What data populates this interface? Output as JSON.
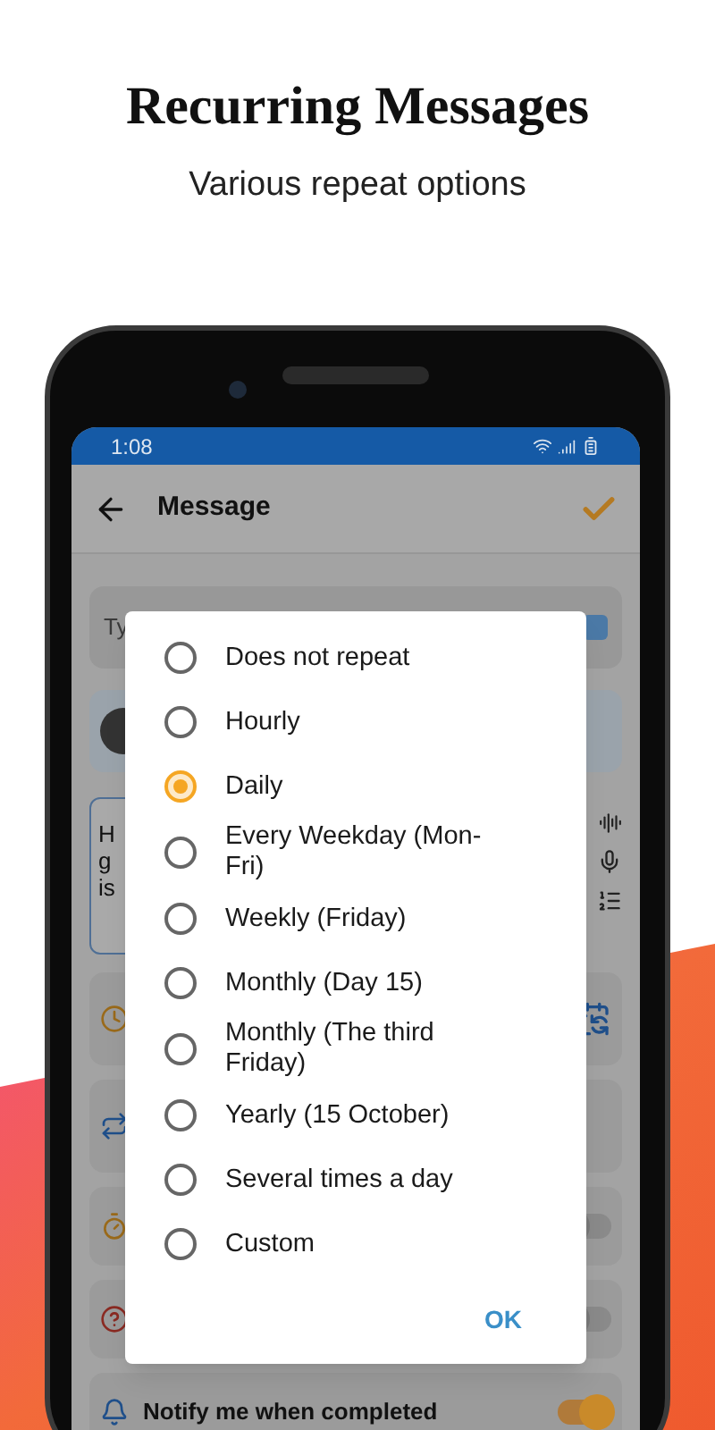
{
  "header": {
    "title": "Recurring Messages",
    "subtitle": "Various repeat options"
  },
  "status_bar": {
    "time": "1:08"
  },
  "app_bar": {
    "title": "Message"
  },
  "compose": {
    "recipient_placeholder": "Ty",
    "message_lines": [
      "H",
      "g",
      "is"
    ]
  },
  "settings": [
    {
      "kind": "schedule"
    },
    {
      "kind": "repeat"
    },
    {
      "kind": "countdown",
      "on": false
    },
    {
      "kind": "confirm",
      "on": false
    },
    {
      "kind": "notify",
      "label": "Notify me when completed",
      "on": true
    }
  ],
  "dialog": {
    "options": [
      {
        "label": "Does not repeat",
        "selected": false
      },
      {
        "label": "Hourly",
        "selected": false
      },
      {
        "label": "Daily",
        "selected": true
      },
      {
        "label": "Every Weekday (Mon-Fri)",
        "selected": false
      },
      {
        "label": "Weekly (Friday)",
        "selected": false
      },
      {
        "label": "Monthly (Day 15)",
        "selected": false
      },
      {
        "label": "Monthly (The third Friday)",
        "selected": false
      },
      {
        "label": "Yearly (15 October)",
        "selected": false
      },
      {
        "label": "Several times a day",
        "selected": false
      },
      {
        "label": "Custom",
        "selected": false
      }
    ],
    "ok": "OK"
  }
}
